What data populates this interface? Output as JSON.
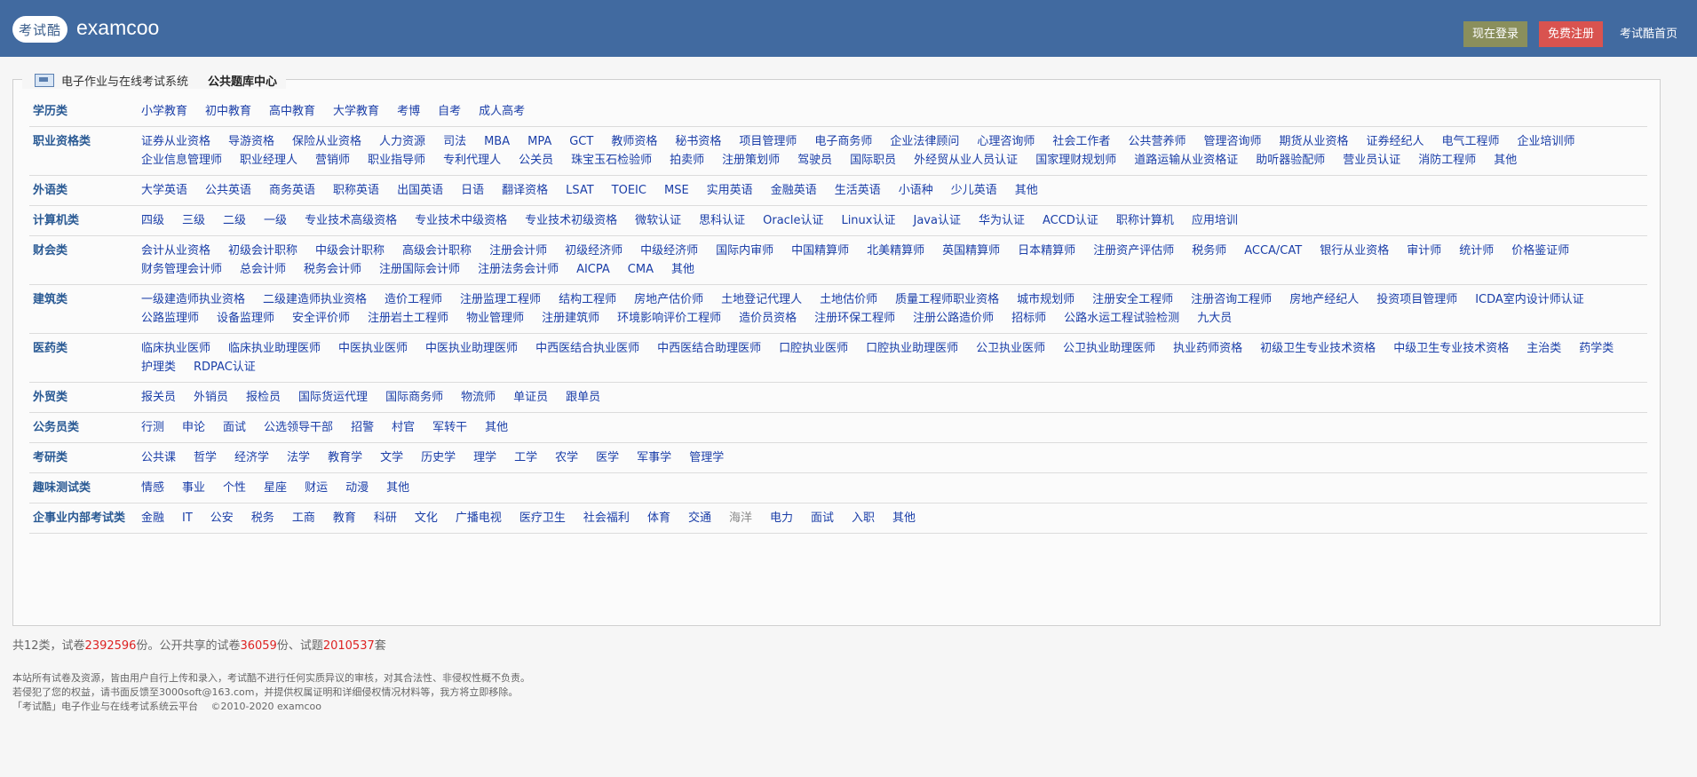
{
  "header": {
    "logo_text": "考试酷",
    "brand": "examcoo",
    "login_label": "现在登录",
    "register_label": "免费注册",
    "home_label": "考试酷首页"
  },
  "panel": {
    "system_title": "电子作业与在线考试系统",
    "current_title": "公共题库中心"
  },
  "categories": [
    {
      "label": "学历类",
      "items": [
        "小学教育",
        "初中教育",
        "高中教育",
        "大学教育",
        "考博",
        "自考",
        "成人高考"
      ]
    },
    {
      "label": "职业资格类",
      "items": [
        "证券从业资格",
        "导游资格",
        "保险从业资格",
        "人力资源",
        "司法",
        "MBA",
        "MPA",
        "GCT",
        "教师资格",
        "秘书资格",
        "项目管理师",
        "电子商务师",
        "企业法律顾问",
        "心理咨询师",
        "社会工作者",
        "公共营养师",
        "管理咨询师",
        "期货从业资格",
        "证券经纪人",
        "电气工程师",
        "企业培训师",
        "企业信息管理师",
        "职业经理人",
        "营销师",
        "职业指导师",
        "专利代理人",
        "公关员",
        "珠宝玉石检验师",
        "拍卖师",
        "注册策划师",
        "驾驶员",
        "国际职员",
        "外经贸从业人员认证",
        "国家理财规划师",
        "道路运输从业资格证",
        "助听器验配师",
        "营业员认证",
        "消防工程师",
        "其他"
      ]
    },
    {
      "label": "外语类",
      "items": [
        "大学英语",
        "公共英语",
        "商务英语",
        "职称英语",
        "出国英语",
        "日语",
        "翻译资格",
        "LSAT",
        "TOEIC",
        "MSE",
        "实用英语",
        "金融英语",
        "生活英语",
        "小语种",
        "少儿英语",
        "其他"
      ]
    },
    {
      "label": "计算机类",
      "items": [
        "四级",
        "三级",
        "二级",
        "一级",
        "专业技术高级资格",
        "专业技术中级资格",
        "专业技术初级资格",
        "微软认证",
        "思科认证",
        "Oracle认证",
        "Linux认证",
        "Java认证",
        "华为认证",
        "ACCD认证",
        "职称计算机",
        "应用培训"
      ]
    },
    {
      "label": "财会类",
      "items": [
        "会计从业资格",
        "初级会计职称",
        "中级会计职称",
        "高级会计职称",
        "注册会计师",
        "初级经济师",
        "中级经济师",
        "国际内审师",
        "中国精算师",
        "北美精算师",
        "英国精算师",
        "日本精算师",
        "注册资产评估师",
        "税务师",
        "ACCA/CAT",
        "银行从业资格",
        "审计师",
        "统计师",
        "价格鉴证师",
        "财务管理会计师",
        "总会计师",
        "税务会计师",
        "注册国际会计师",
        "注册法务会计师",
        "AICPA",
        "CMA",
        "其他"
      ]
    },
    {
      "label": "建筑类",
      "items": [
        "一级建造师执业资格",
        "二级建造师执业资格",
        "造价工程师",
        "注册监理工程师",
        "结构工程师",
        "房地产估价师",
        "土地登记代理人",
        "土地估价师",
        "质量工程师职业资格",
        "城市规划师",
        "注册安全工程师",
        "注册咨询工程师",
        "房地产经纪人",
        "投资项目管理师",
        "ICDA室内设计师认证",
        "公路监理师",
        "设备监理师",
        "安全评价师",
        "注册岩土工程师",
        "物业管理师",
        "注册建筑师",
        "环境影响评价工程师",
        "造价员资格",
        "注册环保工程师",
        "注册公路造价师",
        "招标师",
        "公路水运工程试验检测",
        "九大员"
      ]
    },
    {
      "label": "医药类",
      "items": [
        "临床执业医师",
        "临床执业助理医师",
        "中医执业医师",
        "中医执业助理医师",
        "中西医结合执业医师",
        "中西医结合助理医师",
        "口腔执业医师",
        "口腔执业助理医师",
        "公卫执业医师",
        "公卫执业助理医师",
        "执业药师资格",
        "初级卫生专业技术资格",
        "中级卫生专业技术资格",
        "主治类",
        "药学类",
        "护理类",
        "RDPAC认证"
      ]
    },
    {
      "label": "外贸类",
      "items": [
        "报关员",
        "外销员",
        "报检员",
        "国际货运代理",
        "国际商务师",
        "物流师",
        "单证员",
        "跟单员"
      ]
    },
    {
      "label": "公务员类",
      "items": [
        "行测",
        "申论",
        "面试",
        "公选领导干部",
        "招警",
        "村官",
        "军转干",
        "其他"
      ]
    },
    {
      "label": "考研类",
      "items": [
        "公共课",
        "哲学",
        "经济学",
        "法学",
        "教育学",
        "文学",
        "历史学",
        "理学",
        "工学",
        "农学",
        "医学",
        "军事学",
        "管理学"
      ]
    },
    {
      "label": "趣味测试类",
      "items": [
        "情感",
        "事业",
        "个性",
        "星座",
        "财运",
        "动漫",
        "其他"
      ]
    },
    {
      "label": "企事业内部考试类",
      "items": [
        "金融",
        "IT",
        "公安",
        "税务",
        "工商",
        "教育",
        "科研",
        "文化",
        "广播电视",
        "医疗卫生",
        "社会福利",
        "体育",
        "交通",
        "海洋",
        "电力",
        "面试",
        "入职",
        "其他"
      ]
    }
  ],
  "stats": {
    "prefix": "共12类，试卷",
    "papers": "2392596",
    "mid1": "份。公开共享的试卷",
    "shared": "36059",
    "mid2": "份、试题",
    "questions": "2010537",
    "suffix": "套"
  },
  "footer": {
    "line1": "本站所有试卷及资源，皆由用户自行上传和录入，考试酷不进行任何实质异议的审核，对其合法性、非侵权性概不负责。",
    "line2": "若侵犯了您的权益，请书面反馈至3000soft@163.com，并提供权属证明和详细侵权情况材料等，我方将立即移除。",
    "line3": "「考试酷」电子作业与在线考试系统云平台　  ©2010-2020 examcoo"
  }
}
